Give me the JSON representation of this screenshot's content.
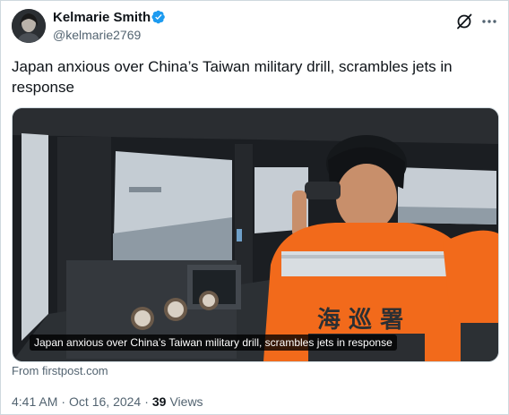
{
  "author": {
    "name": "Kelmarie Smith",
    "handle": "@kelmarie2769",
    "verified_icon": "verified-badge-icon",
    "avatar": "avatar"
  },
  "header_actions": {
    "grok_icon": "grok-icon",
    "more_icon": "more-icon"
  },
  "tweet": {
    "text": "Japan anxious over China’s Taiwan military drill, scrambles jets in response"
  },
  "card": {
    "caption": "Japan anxious over China’s Taiwan military drill, scrambles jets in response",
    "source": "From firstpost.com",
    "vest_text": "海 巡 署"
  },
  "meta": {
    "time": "4:41 AM",
    "separator1": "·",
    "date": "Oct 16, 2024",
    "separator2": "·",
    "views_count": "39",
    "views_label": "Views"
  },
  "colors": {
    "text_primary": "#0f1419",
    "text_secondary": "#536471",
    "verified_blue": "#1d9bf0",
    "vest_orange": "#f26a1b"
  }
}
